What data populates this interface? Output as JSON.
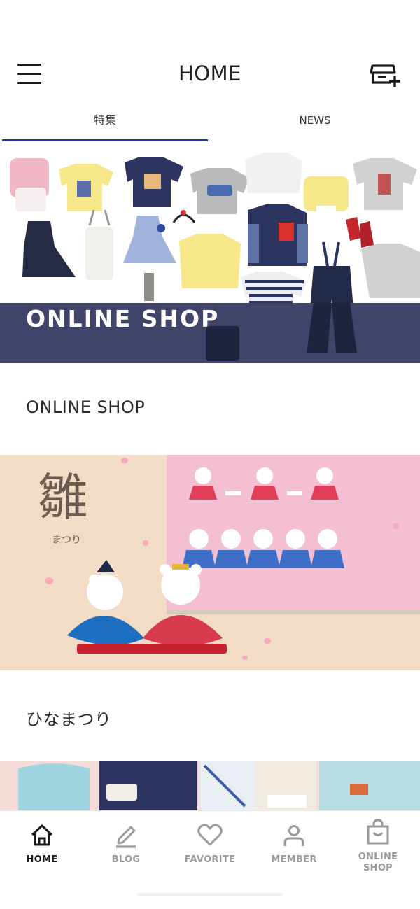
{
  "header": {
    "title": "HOME",
    "menu_icon": "hamburger-menu-icon",
    "shop_icon": "shop-add-icon"
  },
  "tabs": [
    {
      "label": "特集",
      "active": true
    },
    {
      "label": "NEWS",
      "active": false
    }
  ],
  "banners": [
    {
      "overlay_text": "ONLINE SHOP",
      "caption": "ONLINE SHOP"
    },
    {
      "overlay_kanji": "雛",
      "overlay_sub": "まつり",
      "caption": "ひなまつり"
    }
  ],
  "bottom_nav": [
    {
      "label": "HOME",
      "icon": "home-icon",
      "active": true
    },
    {
      "label": "BLOG",
      "icon": "pencil-icon",
      "active": false
    },
    {
      "label": "FAVORITE",
      "icon": "heart-icon",
      "active": false
    },
    {
      "label": "MEMBER",
      "icon": "person-icon",
      "active": false
    },
    {
      "label_line1": "ONLINE",
      "label_line2": "SHOP",
      "icon": "shopping-bag-icon",
      "active": false
    }
  ],
  "colors": {
    "accent": "#1b3c9b",
    "banner_strip": "#3f4468",
    "nav_active": "#1a1a1a",
    "nav_inactive": "#9a9a9a"
  }
}
